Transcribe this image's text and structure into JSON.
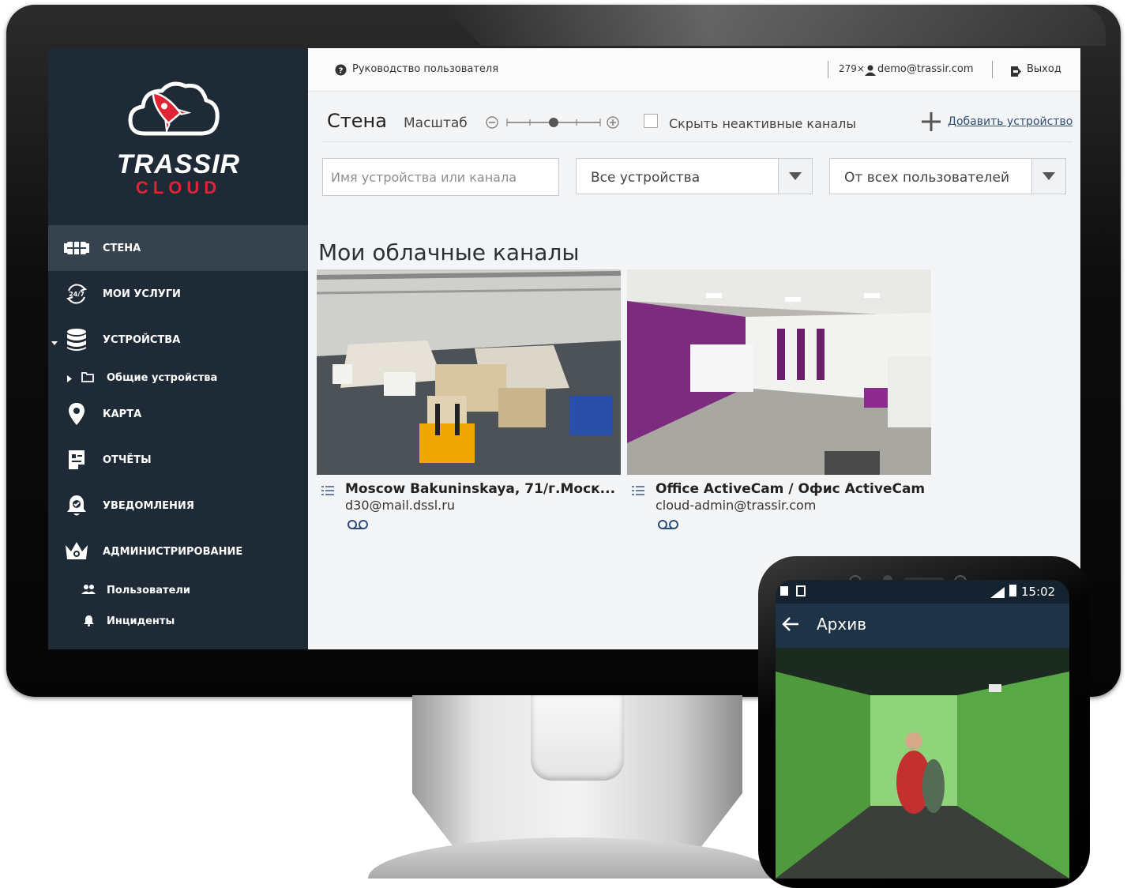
{
  "colors": {
    "sidebar_bg": "#1e2a35",
    "sidebar_active": "#36434f",
    "brand_red": "#e02433",
    "main_bg": "#f4f5f6"
  },
  "logo": {
    "word": "TRASSIR",
    "sub": "CLOUD"
  },
  "sidebar": {
    "items": [
      {
        "label": "СТЕНА",
        "icon": "video-wall-icon",
        "active": true
      },
      {
        "label": "МОИ УСЛУГИ",
        "icon": "services-24-7-icon"
      },
      {
        "label": "УСТРОЙСТВА",
        "icon": "database-icon",
        "expanded": true
      },
      {
        "label": "Общие устройства",
        "icon": "folder-icon",
        "sub": true
      },
      {
        "label": "КАРТА",
        "icon": "map-pin-icon"
      },
      {
        "label": "ОТЧЁТЫ",
        "icon": "report-icon"
      },
      {
        "label": "УВЕДОМЛЕНИЯ",
        "icon": "notification-bell-icon"
      },
      {
        "label": "АДМИНИСТРИРОВАНИЕ",
        "icon": "crown-icon"
      },
      {
        "label": "Пользователи",
        "icon": "users-icon",
        "sub": true
      },
      {
        "label": "Инциденты",
        "icon": "bell-icon",
        "sub": true
      }
    ]
  },
  "topbar": {
    "help_label": "Руководство пользователя",
    "count": "279×",
    "user_email": "demo@trassir.com",
    "logout_label": "Выход"
  },
  "toolbar": {
    "title": "Стена",
    "scale_label": "Масштаб",
    "scale_value": 0.5,
    "hide_inactive_label": "Скрыть неактивные каналы",
    "hide_inactive_checked": false,
    "add_device_label": "Добавить устройство"
  },
  "filters": {
    "search_placeholder": "Имя устройства или канала",
    "devices_value": "Все устройства",
    "users_value": "От всех пользователей"
  },
  "section_title": "Мои облачные каналы",
  "channels": [
    {
      "title": "Moscow Bakuninskaya, 71/г.Моск...",
      "owner": "d30@mail.dssl.ru"
    },
    {
      "title": "Office ActiveCam / Офис ActiveCam",
      "owner": "cloud-admin@trassir.com"
    }
  ],
  "phone": {
    "time": "15:02",
    "screen_title": "Архив"
  }
}
